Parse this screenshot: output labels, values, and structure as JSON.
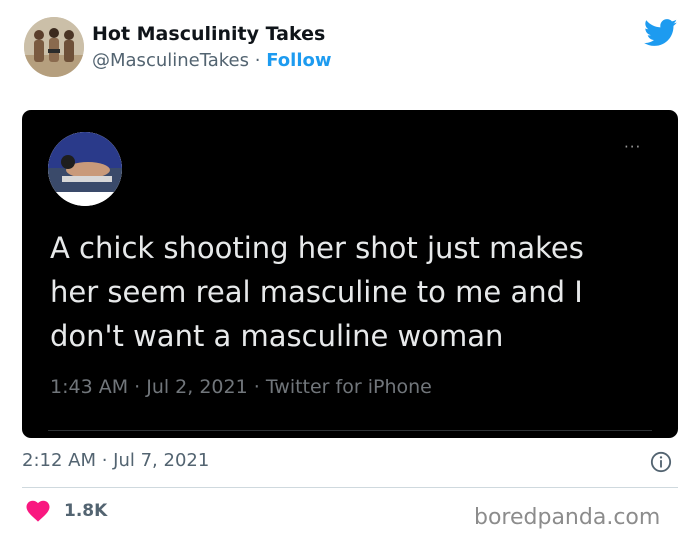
{
  "author": {
    "name": "Hot Masculinity Takes",
    "handle": "@MasculineTakes",
    "separator": "·",
    "follow_label": "Follow"
  },
  "icons": {
    "brand": "twitter-bird-icon",
    "info": "info-icon",
    "like": "heart-icon",
    "more": "more-dots-icon"
  },
  "embedded_tweet": {
    "text": "A chick shooting her shot just makes her seem real masculine to me and I don't want a masculine woman",
    "meta": "1:43 AM · Jul 2, 2021 · Twitter for iPhone",
    "more_label": "···"
  },
  "footer": {
    "timestamp": "2:12 AM · Jul 7, 2021",
    "likes": "1.8K"
  },
  "watermark": "boredpanda.com",
  "colors": {
    "brand_blue": "#1d9bf0",
    "like_pink": "#f91880",
    "embed_bg": "#000000",
    "muted_text": "#536471"
  }
}
